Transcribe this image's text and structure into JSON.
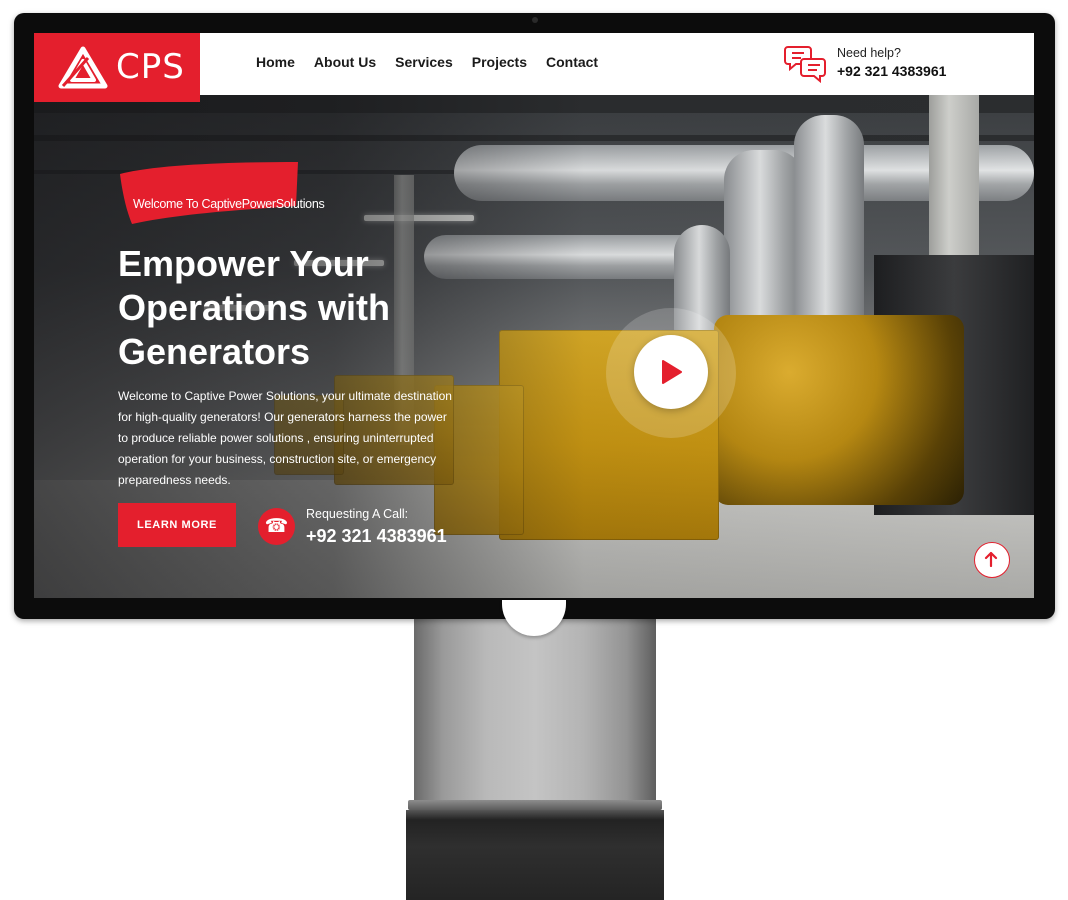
{
  "brand": {
    "name": "CPS",
    "color": "#e41f2d"
  },
  "nav": {
    "items": [
      "Home",
      "About Us",
      "Services",
      "Projects",
      "Contact"
    ]
  },
  "help": {
    "label": "Need help?",
    "phone": "+92 321 4383961",
    "icon": "chat-bubbles-icon"
  },
  "hero": {
    "badge": "Welcome To CaptivePowerSolutions",
    "headline_lines": [
      "Empower Your",
      "Operations with",
      "Generators"
    ],
    "description": "Welcome to Captive Power Solutions, your ultimate destination for high-quality generators! Our generators harness the power to produce reliable power solutions , ensuring uninterrupted operation for your business, construction site, or emergency preparedness needs.",
    "cta_label": "LEARN MORE",
    "call_label": "Requesting A Call:",
    "call_phone": "+92 321 4383961",
    "call_icon": "telephone-icon",
    "play_icon": "play-icon",
    "scroll_top_icon": "arrow-up-icon"
  },
  "colors": {
    "accent": "#e41f2d",
    "text_dark": "#1b1b1b",
    "white": "#ffffff"
  }
}
